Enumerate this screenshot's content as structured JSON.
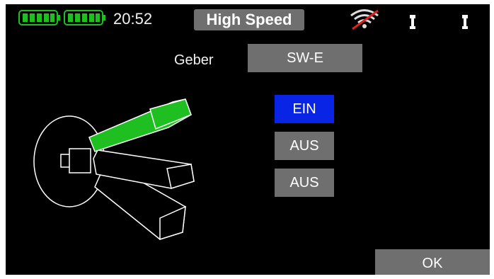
{
  "status": {
    "time": "20:52",
    "mode_title": "High Speed",
    "battery_color": "#1fbf22",
    "icons": [
      "battery-icon",
      "battery-icon",
      "wifi-off-icon",
      "trim-icon",
      "trim-icon"
    ]
  },
  "geber": {
    "label": "Geber",
    "value": "SW-E"
  },
  "positions": [
    {
      "label": "EIN",
      "active": true
    },
    {
      "label": "AUS",
      "active": false
    },
    {
      "label": "AUS",
      "active": false
    }
  ],
  "ok_label": "OK",
  "colors": {
    "active_button": "#0a24e6",
    "button": "#6f6f6f",
    "switch_active": "#1fbf22"
  }
}
